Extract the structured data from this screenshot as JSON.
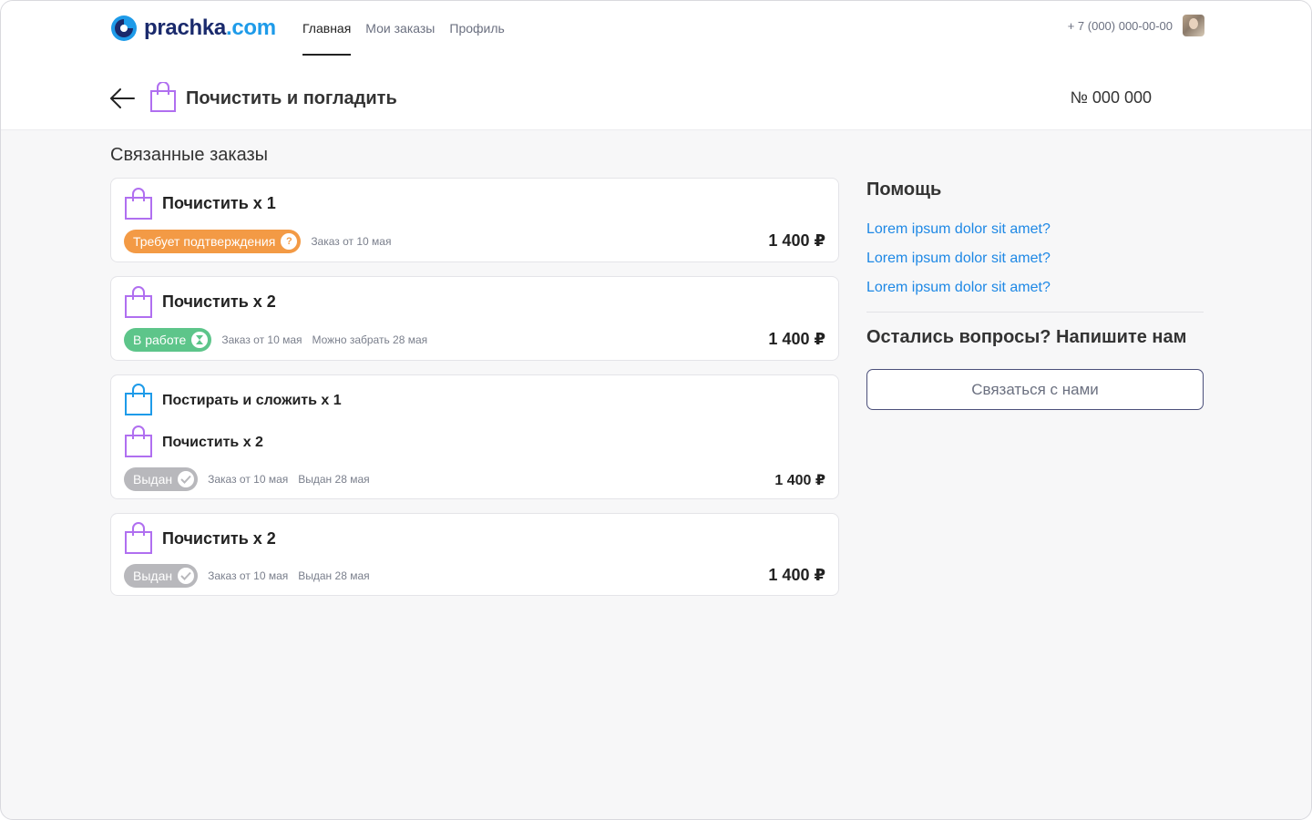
{
  "header": {
    "logo": {
      "part1": "prachka",
      "part2": ".com"
    },
    "nav": [
      "Главная",
      "Мои заказы",
      "Профиль"
    ],
    "active_nav": 0,
    "phone": "+ 7 (000) 000-00-00"
  },
  "subheader": {
    "title": "Почистить и погладить",
    "order_number": "№ 000 000"
  },
  "related": {
    "title": "Связанные заказы",
    "orders": [
      {
        "items": [
          "Почистить x 1"
        ],
        "status": "Требует подтверждения",
        "status_icon": "?",
        "meta1": "Заказ от 10 мая",
        "meta2": "",
        "price": "1 400 ₽"
      },
      {
        "items": [
          "Почистить x 2"
        ],
        "status": "В работе",
        "status_icon": "hourglass-icon",
        "meta1": "Заказ от 10 мая",
        "meta2": "Можно забрать 28 мая",
        "price": "1 400 ₽"
      },
      {
        "items": [
          "Постирать и сложить x 1",
          "Почистить x 2"
        ],
        "status": "Выдан",
        "status_icon": "check-icon",
        "meta1": "Заказ от 10 мая",
        "meta2": "Выдан 28 мая",
        "price": "1 400 ₽"
      },
      {
        "items": [
          "Почистить x 2"
        ],
        "status": "Выдан",
        "status_icon": "check-icon",
        "meta1": "Заказ от 10 мая",
        "meta2": "Выдан 28 мая",
        "price": "1 400 ₽"
      }
    ]
  },
  "help": {
    "title": "Помощь",
    "links": [
      "Lorem ipsum dolor sit amet?",
      "Lorem ipsum dolor sit amet?",
      "Lorem ipsum dolor sit amet?"
    ],
    "question": "Остались вопросы? Напишите нам",
    "contact_button": "Связаться с нами"
  },
  "colors": {
    "accent": "#1e88e5",
    "bag_purple": "#b06ff0",
    "bag_blue": "#1e9be9",
    "status_orange": "#f39a45",
    "status_green": "#5dc58a",
    "status_grey": "#b8b8bc"
  }
}
